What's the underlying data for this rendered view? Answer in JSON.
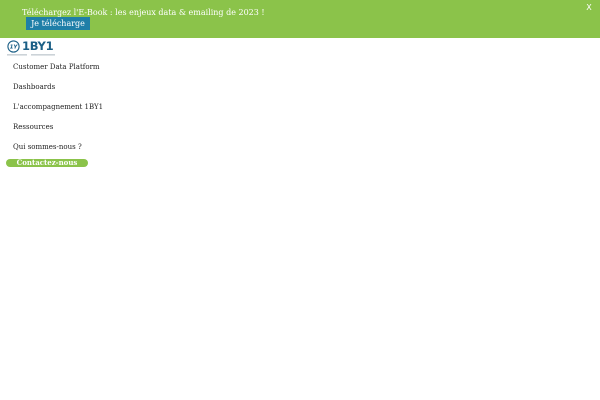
{
  "banner": {
    "text": "Téléchargez l'E-Book : les enjeux data & emailing de 2023 !",
    "button_label": "Je télécharge",
    "close_label": "X",
    "color": "#8bc34a",
    "button_color": "#1f7fa8"
  },
  "logo": {
    "text": "1BY1",
    "mark_icon": "1by1-logo-mark",
    "color": "#1b5f86"
  },
  "nav": {
    "items": [
      {
        "label": "Customer Data Platform"
      },
      {
        "label": "Dashboards"
      },
      {
        "label": "L'accompagnement 1BY1"
      },
      {
        "label": "Ressources"
      },
      {
        "label": "Qui sommes-nous ?"
      }
    ]
  },
  "cta": {
    "label": "Contactez-nous",
    "color": "#8bc34a"
  }
}
